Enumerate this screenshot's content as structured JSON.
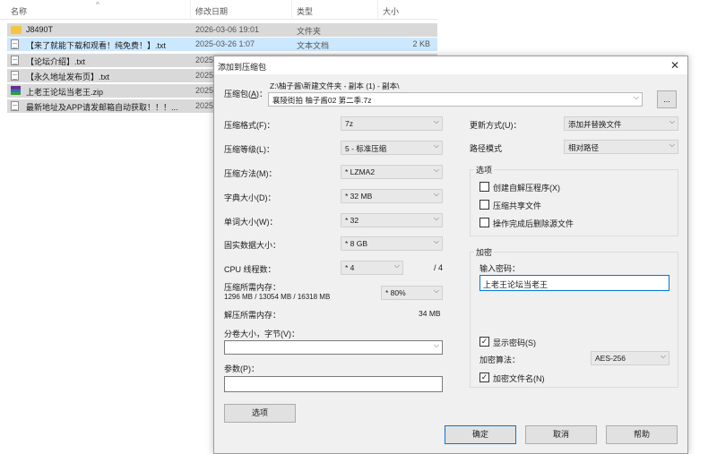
{
  "explorer": {
    "columns": {
      "name": "名称",
      "date": "修改日期",
      "type": "类型",
      "size": "大小"
    },
    "files": [
      {
        "name": "J8490T",
        "date": "2026-03-06 19:01",
        "type": "文件夹",
        "size": "",
        "icon": "folder-icon"
      },
      {
        "name": "【来了就能下载和观看！纯免费！】.txt",
        "date": "2025-03-26 1:07",
        "type": "文本文档",
        "size": "2 KB",
        "icon": "text-file-icon"
      },
      {
        "name": "【论坛介绍】.txt",
        "date": "2025",
        "type": "",
        "size": "",
        "icon": "text-file-icon"
      },
      {
        "name": "【永久地址发布页】.txt",
        "date": "2025",
        "type": "",
        "size": "",
        "icon": "text-file-icon"
      },
      {
        "name": "上老王论坛当老王.zip",
        "date": "2025",
        "type": "",
        "size": "",
        "icon": "zip-file-icon"
      },
      {
        "name": "最新地址及APP请发邮箱自动获取！！！...",
        "date": "2025",
        "type": "",
        "size": "",
        "icon": "text-file-icon"
      }
    ]
  },
  "dialog": {
    "title": "添加到压缩包",
    "archive": {
      "label": "压缩包(A)：",
      "label_text": "压缩包",
      "label_key": "A",
      "path": "Z:\\柚子酱\\新建文件夹 - 副本 (1) - 副本\\",
      "filename": "襄陵街拍 柚子酱02 第二季.7z",
      "browse_label": "..."
    },
    "left": {
      "format": {
        "label": "压缩格式(F)：",
        "value": "7z"
      },
      "level": {
        "label": "压缩等级(L)：",
        "value": "5 - 标准压缩"
      },
      "method": {
        "label": "压缩方法(M)：",
        "value": "* LZMA2"
      },
      "dict": {
        "label": "字典大小(D)：",
        "value": "* 32 MB"
      },
      "word": {
        "label": "单词大小(W)：",
        "value": "* 32"
      },
      "solid": {
        "label": "固实数据大小：",
        "value": "* 8 GB"
      },
      "threads": {
        "label": "CPU 线程数：",
        "value": "* 4",
        "max": "/ 4"
      },
      "mem_compress": {
        "label": "压缩所需内存：",
        "detail": "1296 MB / 13054 MB / 16318 MB",
        "value": "* 80%"
      },
      "mem_decompress": {
        "label": "解压所需内存：",
        "value": "34 MB"
      },
      "volume": {
        "label": "分卷大小，字节(V)：",
        "value": ""
      },
      "params": {
        "label": "参数(P)：",
        "value": ""
      },
      "options_button": "选项"
    },
    "right": {
      "update": {
        "label": "更新方式(U)：",
        "value": "添加并替换文件"
      },
      "path_mode": {
        "label": "路径模式",
        "value": "相对路径"
      },
      "options_group": {
        "title": "选项",
        "items": [
          {
            "label": "创建自解压程序(X)",
            "checked": false
          },
          {
            "label": "压缩共享文件",
            "checked": false
          },
          {
            "label": "操作完成后删除源文件",
            "checked": false
          }
        ]
      },
      "encryption_group": {
        "title": "加密",
        "password_label": "输入密码：",
        "password": "上老王论坛当老王",
        "show_password": {
          "label": "显示密码(S)",
          "checked": true
        },
        "method_label": "加密算法：",
        "method": "AES-256",
        "encrypt_names": {
          "label": "加密文件名(N)",
          "checked": true
        }
      }
    },
    "buttons": {
      "ok": "确定",
      "cancel": "取消",
      "help": "帮助"
    }
  },
  "colors": {
    "selection": "#cce8ff",
    "selected_gray": "#d9d9d9",
    "dialog_bg": "#f0f0f0",
    "focus_border": "#0078d7"
  }
}
